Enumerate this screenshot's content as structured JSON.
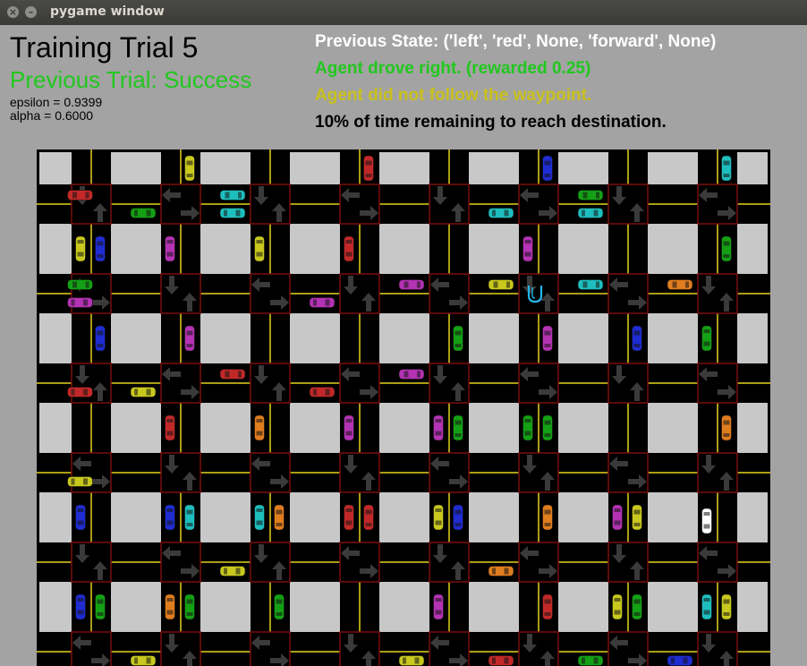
{
  "window": {
    "title": "pygame window",
    "close_glyph": "×",
    "min_glyph": "–"
  },
  "hud": {
    "trial_title": "Training Trial 5",
    "previous_trial": "Previous Trial: Success",
    "epsilon": "epsilon = 0.9399",
    "alpha": "alpha = 0.6000",
    "previous_state": "Previous State: ('left', 'red', None, 'forward', None)",
    "action_msg": "Agent drove right. (rewarded 0.25)",
    "waypoint_msg": "Agent did not follow the waypoint.",
    "time_msg": "10% of time remaining to reach destination."
  },
  "colors": {
    "background": "#a3a3a3",
    "road": "#000000",
    "block": "#c8c8c8",
    "lane_line": "#e4d21c",
    "stop_line": "#7a0e0e",
    "arrow": "#3a3a3a",
    "title_text": "#000000",
    "success_text": "#21c81e",
    "state_text": "#ffffff",
    "action_text": "#21c81e",
    "waypoint_text": "#c8c01c",
    "time_text": "#000000",
    "agent_car": "#ffffff",
    "destination_marker": "#23b5e8",
    "car_palette": {
      "red": "#c22828",
      "green": "#14a014",
      "blue": "#1e2cd2",
      "cyan": "#1ebebe",
      "yellow": "#c8c81e",
      "orange": "#e07d1e",
      "magenta": "#b432b4"
    }
  },
  "grid": {
    "columns": 8,
    "rows": 6
  },
  "cars": [
    {
      "color": "yellow",
      "col": 1,
      "row": 0,
      "heading": "N"
    },
    {
      "color": "red",
      "col": 3,
      "row": 0,
      "heading": "N"
    },
    {
      "color": "blue",
      "col": 5,
      "row": 0,
      "heading": "N"
    },
    {
      "color": "cyan",
      "col": 7,
      "row": 0,
      "heading": "N"
    },
    {
      "color": "red",
      "col": 0,
      "row": 1,
      "heading": "W"
    },
    {
      "color": "cyan",
      "col": 2,
      "row": 1,
      "heading": "W"
    },
    {
      "color": "green",
      "col": 1,
      "row": 1,
      "heading": "E"
    },
    {
      "color": "cyan",
      "col": 2,
      "row": 1,
      "heading": "E"
    },
    {
      "color": "green",
      "col": 6,
      "row": 1,
      "heading": "W"
    },
    {
      "color": "cyan",
      "col": 5,
      "row": 1,
      "heading": "E"
    },
    {
      "color": "cyan",
      "col": 6,
      "row": 1,
      "heading": "E"
    },
    {
      "color": "yellow",
      "col": 0,
      "row": 1,
      "heading": "S"
    },
    {
      "color": "blue",
      "col": 0,
      "row": 1,
      "heading": "N"
    },
    {
      "color": "magenta",
      "col": 1,
      "row": 1,
      "heading": "S"
    },
    {
      "color": "yellow",
      "col": 2,
      "row": 1,
      "heading": "S"
    },
    {
      "color": "red",
      "col": 3,
      "row": 1,
      "heading": "S"
    },
    {
      "color": "magenta",
      "col": 5,
      "row": 1,
      "heading": "S"
    },
    {
      "color": "green",
      "col": 7,
      "row": 1,
      "heading": "N"
    },
    {
      "color": "green",
      "col": 0,
      "row": 2,
      "heading": "W"
    },
    {
      "color": "magenta",
      "col": 0,
      "row": 2,
      "heading": "E"
    },
    {
      "color": "magenta",
      "col": 3,
      "row": 2,
      "heading": "E"
    },
    {
      "color": "magenta",
      "col": 4,
      "row": 2,
      "heading": "W"
    },
    {
      "color": "yellow",
      "col": 5,
      "row": 2,
      "heading": "W"
    },
    {
      "color": "cyan",
      "col": 6,
      "row": 2,
      "heading": "W"
    },
    {
      "color": "orange",
      "col": 7,
      "row": 2,
      "heading": "W"
    },
    {
      "color": "blue",
      "col": 0,
      "row": 2,
      "heading": "N"
    },
    {
      "color": "magenta",
      "col": 1,
      "row": 2,
      "heading": "N"
    },
    {
      "color": "green",
      "col": 4,
      "row": 2,
      "heading": "N"
    },
    {
      "color": "magenta",
      "col": 5,
      "row": 2,
      "heading": "N"
    },
    {
      "color": "blue",
      "col": 6,
      "row": 2,
      "heading": "N"
    },
    {
      "color": "green",
      "col": 7,
      "row": 2,
      "heading": "S"
    },
    {
      "color": "red",
      "col": 2,
      "row": 3,
      "heading": "W"
    },
    {
      "color": "magenta",
      "col": 4,
      "row": 3,
      "heading": "W"
    },
    {
      "color": "red",
      "col": 0,
      "row": 3,
      "heading": "E"
    },
    {
      "color": "yellow",
      "col": 1,
      "row": 3,
      "heading": "E"
    },
    {
      "color": "red",
      "col": 3,
      "row": 3,
      "heading": "E"
    },
    {
      "color": "green",
      "col": 4,
      "row": 3,
      "heading": "N"
    },
    {
      "color": "red",
      "col": 1,
      "row": 3,
      "heading": "S"
    },
    {
      "color": "orange",
      "col": 2,
      "row": 3,
      "heading": "S"
    },
    {
      "color": "magenta",
      "col": 3,
      "row": 3,
      "heading": "S"
    },
    {
      "color": "magenta",
      "col": 4,
      "row": 3,
      "heading": "S"
    },
    {
      "color": "green",
      "col": 5,
      "row": 3,
      "heading": "S"
    },
    {
      "color": "green",
      "col": 5,
      "row": 3,
      "heading": "N"
    },
    {
      "color": "orange",
      "col": 7,
      "row": 3,
      "heading": "N"
    },
    {
      "color": "yellow",
      "col": 0,
      "row": 4,
      "heading": "E"
    },
    {
      "color": "blue",
      "col": 0,
      "row": 4,
      "heading": "S"
    },
    {
      "color": "blue",
      "col": 1,
      "row": 4,
      "heading": "S"
    },
    {
      "color": "cyan",
      "col": 1,
      "row": 4,
      "heading": "N"
    },
    {
      "color": "cyan",
      "col": 2,
      "row": 4,
      "heading": "S"
    },
    {
      "color": "orange",
      "col": 2,
      "row": 4,
      "heading": "N"
    },
    {
      "color": "red",
      "col": 3,
      "row": 4,
      "heading": "S"
    },
    {
      "color": "red",
      "col": 3,
      "row": 4,
      "heading": "N"
    },
    {
      "color": "yellow",
      "col": 4,
      "row": 4,
      "heading": "S"
    },
    {
      "color": "blue",
      "col": 4,
      "row": 4,
      "heading": "N"
    },
    {
      "color": "orange",
      "col": 5,
      "row": 4,
      "heading": "N"
    },
    {
      "color": "magenta",
      "col": 6,
      "row": 4,
      "heading": "S"
    },
    {
      "color": "yellow",
      "col": 6,
      "row": 4,
      "heading": "N"
    },
    {
      "color": "yellow",
      "col": 2,
      "row": 5,
      "heading": "E"
    },
    {
      "color": "orange",
      "col": 5,
      "row": 5,
      "heading": "E"
    },
    {
      "color": "blue",
      "col": 0,
      "row": 5,
      "heading": "S"
    },
    {
      "color": "green",
      "col": 0,
      "row": 5,
      "heading": "N"
    },
    {
      "color": "orange",
      "col": 1,
      "row": 5,
      "heading": "S"
    },
    {
      "color": "green",
      "col": 1,
      "row": 5,
      "heading": "N"
    },
    {
      "color": "green",
      "col": 2,
      "row": 5,
      "heading": "N"
    },
    {
      "color": "magenta",
      "col": 4,
      "row": 5,
      "heading": "S"
    },
    {
      "color": "red",
      "col": 5,
      "row": 5,
      "heading": "N"
    },
    {
      "color": "yellow",
      "col": 6,
      "row": 5,
      "heading": "S"
    },
    {
      "color": "green",
      "col": 6,
      "row": 5,
      "heading": "N"
    },
    {
      "color": "cyan",
      "col": 7,
      "row": 5,
      "heading": "S"
    },
    {
      "color": "yellow",
      "col": 7,
      "row": 5,
      "heading": "N"
    },
    {
      "color": "yellow",
      "col": 1,
      "row": 6,
      "heading": "E"
    },
    {
      "color": "red",
      "col": 5,
      "row": 6,
      "heading": "E"
    },
    {
      "color": "green",
      "col": 6,
      "row": 6,
      "heading": "E"
    },
    {
      "color": "blue",
      "col": 7,
      "row": 6,
      "heading": "E"
    },
    {
      "color": "yellow",
      "col": 4,
      "row": 6,
      "heading": "E"
    }
  ],
  "agent": {
    "col": 7,
    "row": 4,
    "heading": "S"
  },
  "destination": {
    "col": 5,
    "row": 2,
    "label": "U"
  }
}
